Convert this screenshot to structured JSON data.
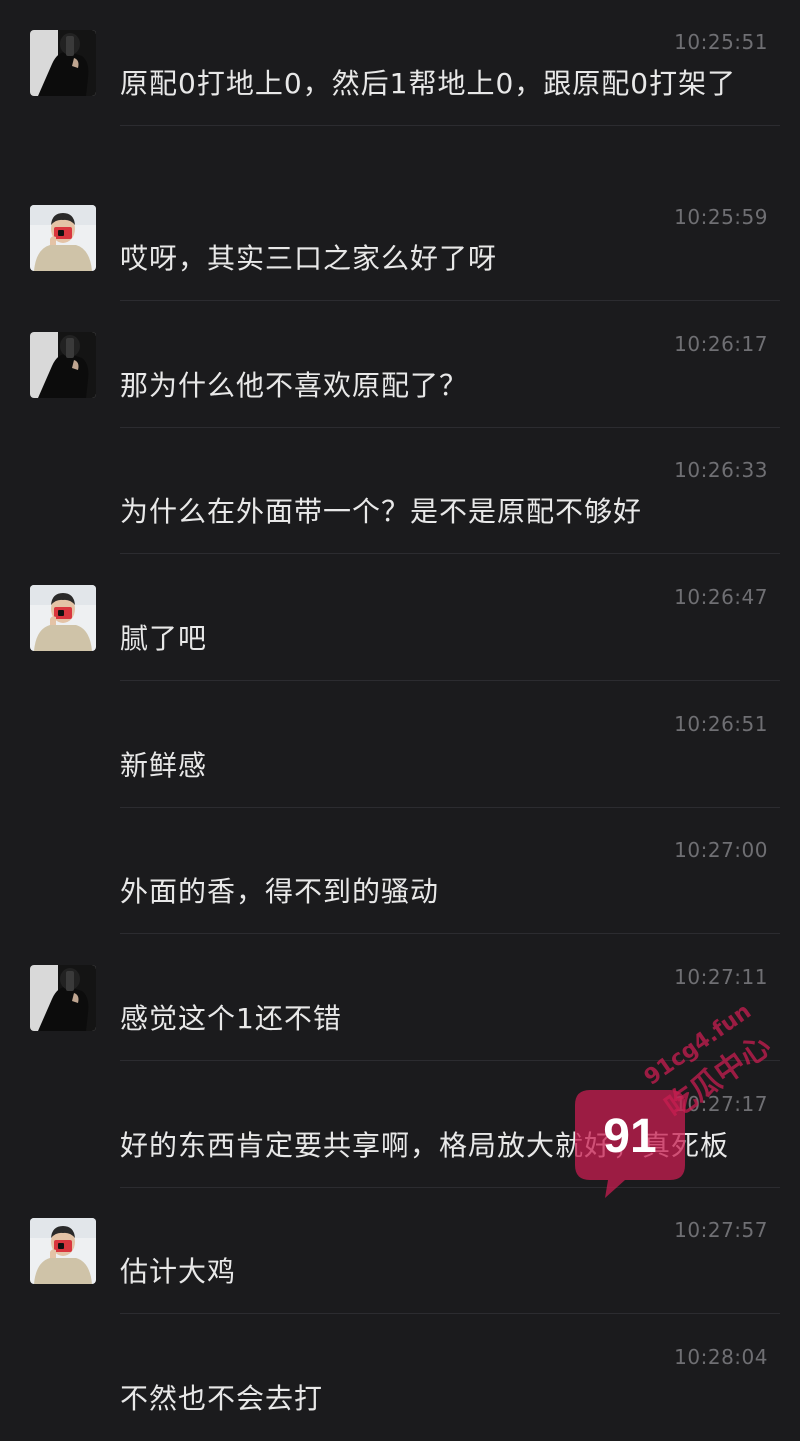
{
  "messages": [
    {
      "avatar": "dark-photo",
      "time": "10:25:51",
      "text": "原配0打地上0，然后1帮地上0，跟原配0打架了"
    },
    {
      "avatar": "light-photo",
      "time": "10:25:59",
      "text": "哎呀，其实三口之家么好了呀"
    },
    {
      "avatar": "dark-photo",
      "time": "10:26:17",
      "text": "那为什么他不喜欢原配了？"
    },
    {
      "avatar": null,
      "time": "10:26:33",
      "text": "为什么在外面带一个？是不是原配不够好"
    },
    {
      "avatar": "light-photo",
      "time": "10:26:47",
      "text": "腻了吧"
    },
    {
      "avatar": null,
      "time": "10:26:51",
      "text": "新鲜感"
    },
    {
      "avatar": null,
      "time": "10:27:00",
      "text": "外面的香，得不到的骚动"
    },
    {
      "avatar": "dark-photo",
      "time": "10:27:11",
      "text": "感觉这个1还不错"
    },
    {
      "avatar": null,
      "time": "10:27:17",
      "text": "好的东西肯定要共享啊，格局放大就好，真死板"
    },
    {
      "avatar": "light-photo",
      "time": "10:27:57",
      "text": "估计大鸡"
    },
    {
      "avatar": null,
      "time": "10:28:04",
      "text": "不然也不会去打"
    }
  ],
  "watermark": {
    "number": "91",
    "domain": "91cg4.fun",
    "label": "吃瓜中心"
  },
  "colors": {
    "background": "#1b1b1d",
    "text": "#e8e8e8",
    "time": "#6f6f73",
    "watermark": "#c81e50"
  }
}
